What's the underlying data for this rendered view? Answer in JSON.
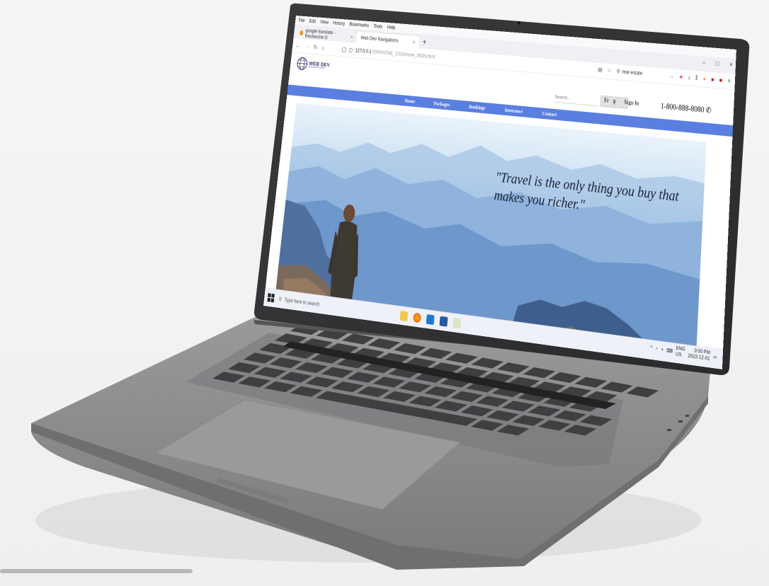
{
  "browser": {
    "menu": [
      "File",
      "Edit",
      "View",
      "History",
      "Bookmarks",
      "Tools",
      "Help"
    ],
    "tabs": [
      {
        "title": "google translate - Recherche G",
        "close": "×"
      },
      {
        "title": "Web Dev Navigations",
        "close": "×"
      }
    ],
    "new_tab": "+",
    "window_controls": [
      "–",
      "□",
      "×"
    ],
    "url": {
      "host": "127.0.0.1",
      "path": ":5500/HTML_CSS/home_WDN.html"
    },
    "find_text": "real estate"
  },
  "site": {
    "logo": {
      "title": "WEB DEV",
      "subtitle": "NAVIGATIONS"
    },
    "search_placeholder": "Search...",
    "search_button_icon": "magnifier-icon",
    "language": "Fr",
    "sign_in": "Sign In",
    "phone": "1-800-888-8080",
    "nav": [
      "Home",
      "Packages",
      "Bookings",
      "Insurance",
      "Contact"
    ],
    "hero_quote": "\"Travel is the only thing you buy that makes you richer.\""
  },
  "taskbar": {
    "search_placeholder": "Type here to search",
    "tray": {
      "lang": "ENG",
      "region": "US",
      "time": "3:00 PM",
      "date": "2022-12-01"
    }
  },
  "colors": {
    "nav_bar": "#5a7fe0",
    "laptop_body": "#8d8d8f",
    "keyboard_keys": "#3f3f42"
  }
}
